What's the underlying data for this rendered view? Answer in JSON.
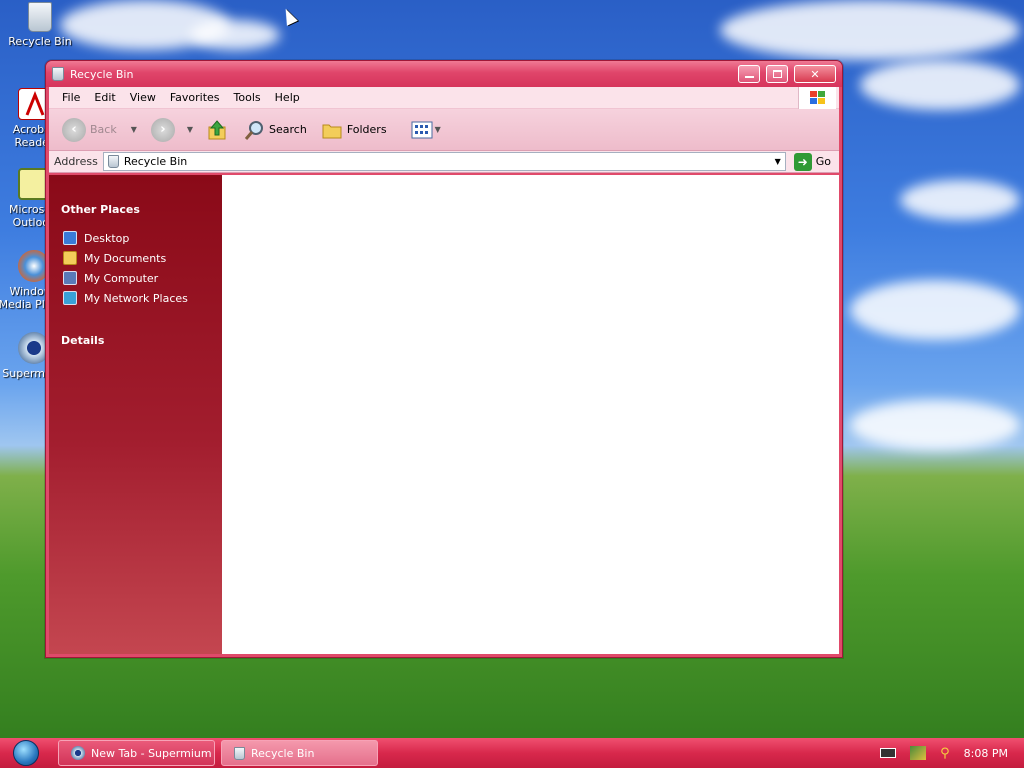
{
  "desktop": {
    "icons": [
      {
        "label": "Recycle Bin",
        "icon": "recycle-bin-icon"
      },
      {
        "label": "Acrobat Reader",
        "icon": "acrobat-reader-icon"
      },
      {
        "label": "Microsoft Outlook",
        "icon": "outlook-icon"
      },
      {
        "label": "Windows Media Player",
        "icon": "media-player-icon"
      },
      {
        "label": "Supermium",
        "icon": "supermium-icon"
      }
    ]
  },
  "window": {
    "title": "Recycle Bin",
    "title_icon": "recycle-bin-icon",
    "controls": {
      "minimize": "minimize-icon",
      "restore": "restore-icon",
      "close": "close-icon"
    }
  },
  "menu": {
    "items": [
      "File",
      "Edit",
      "View",
      "Favorites",
      "Tools",
      "Help"
    ],
    "logo": "windows-flag-icon"
  },
  "toolbar": {
    "back_label": "Back",
    "search_label": "Search",
    "folders_label": "Folders",
    "icons": {
      "back": "back-arrow-icon",
      "forward": "forward-arrow-icon",
      "up": "up-folder-icon",
      "search": "magnifier-icon",
      "folders": "folders-icon",
      "views": "views-icon"
    }
  },
  "address": {
    "label": "Address",
    "value": "Recycle Bin",
    "go_label": "Go"
  },
  "sidebar": {
    "other_places_title": "Other Places",
    "places": [
      {
        "label": "Desktop",
        "icon": "desktop-icon"
      },
      {
        "label": "My Documents",
        "icon": "my-documents-icon"
      },
      {
        "label": "My Computer",
        "icon": "my-computer-icon"
      },
      {
        "label": "My Network Places",
        "icon": "network-places-icon"
      }
    ],
    "details_title": "Details"
  },
  "taskbar": {
    "tasks": [
      {
        "label": "New Tab - Supermium",
        "icon": "supermium-icon"
      },
      {
        "label": "Recycle Bin",
        "icon": "recycle-bin-icon"
      }
    ],
    "clock": "8:08 PM"
  },
  "colors": {
    "accent": "#d8284c",
    "sidebar_top": "#8a0a18"
  }
}
